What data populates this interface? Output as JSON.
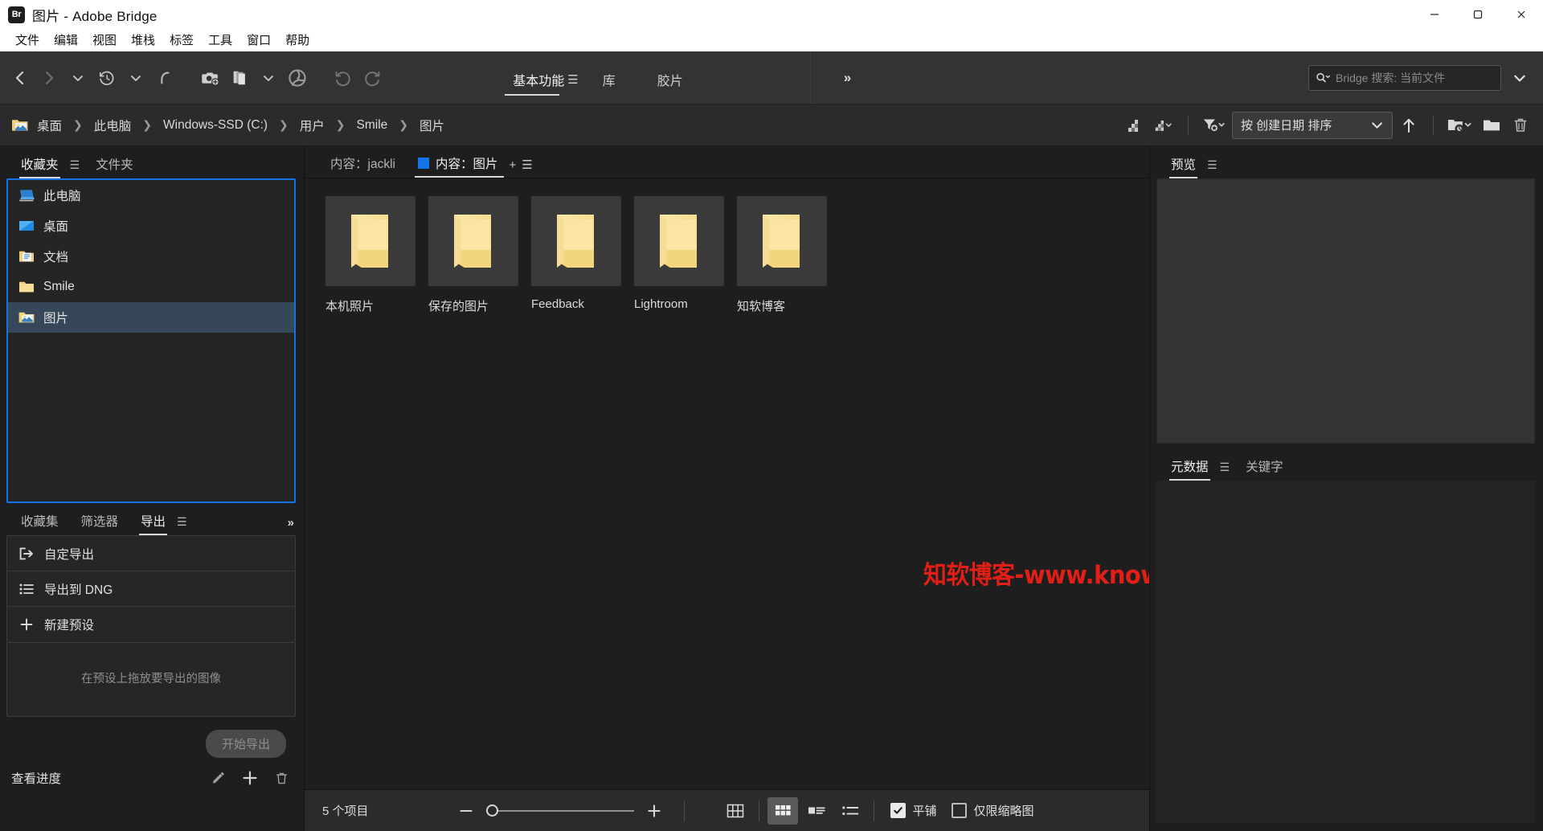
{
  "window": {
    "app_badge": "Br",
    "title": "图片 - Adobe Bridge",
    "controls": {
      "minimize": "minimize-icon",
      "maximize": "maximize-icon",
      "close": "close-icon"
    }
  },
  "menubar": {
    "items": [
      {
        "label": "文件"
      },
      {
        "label": "编辑"
      },
      {
        "label": "视图"
      },
      {
        "label": "堆栈"
      },
      {
        "label": "标签"
      },
      {
        "label": "工具"
      },
      {
        "label": "窗口"
      },
      {
        "label": "帮助"
      }
    ]
  },
  "toolbar": {
    "nav": [
      {
        "name": "back-icon",
        "title": "后退"
      },
      {
        "name": "forward-icon",
        "title": "前进"
      },
      {
        "name": "chevron-down-icon",
        "title": "最近访问"
      },
      {
        "name": "history-clock-icon",
        "title": "历史记录"
      },
      {
        "name": "chevron-down-icon",
        "title": "历史记录菜单"
      },
      {
        "name": "go-to-parent-icon",
        "title": "转到父文件夹"
      }
    ],
    "tools": [
      {
        "name": "camera-import-icon",
        "title": "从相机获取照片"
      },
      {
        "name": "copy-files-icon",
        "title": "优化照片"
      },
      {
        "name": "chevron-down-icon",
        "title": "优化菜单"
      },
      {
        "name": "aperture-icon",
        "title": "在 Camera Raw 中打开"
      }
    ],
    "rotate": [
      {
        "name": "rotate-ccw-icon",
        "title": "逆时针旋转"
      },
      {
        "name": "rotate-cw-icon",
        "title": "顺时针旋转"
      }
    ],
    "workspaces": [
      {
        "label": "基本功能",
        "active": true
      },
      {
        "label": "库",
        "active": false
      },
      {
        "label": "胶片",
        "active": false
      }
    ],
    "workspace_menu_icon": "hamburger-icon",
    "overflow_label": "»",
    "search": {
      "icon": "search-icon",
      "placeholder": "Bridge 搜索: 当前文件",
      "value": "",
      "dropdown_icon": "chevron-down-icon"
    }
  },
  "pathbar": {
    "root_icon": "pictures-folder-icon",
    "crumbs": [
      {
        "label": "桌面"
      },
      {
        "label": "此电脑"
      },
      {
        "label": "Windows-SSD (C:)"
      },
      {
        "label": "用户"
      },
      {
        "label": "Smile"
      },
      {
        "label": "图片"
      }
    ],
    "separator": "❯",
    "actions": [
      {
        "name": "rating-filter-icon",
        "title": "按评级过滤"
      },
      {
        "name": "rating-filter-menu-icon",
        "title": "评级菜单"
      },
      {
        "name": "filter-funnel-icon",
        "title": "筛选项目"
      }
    ],
    "sort": {
      "label": "按 创建日期 排序",
      "dropdown_icon": "chevron-down-icon"
    },
    "sort_direction_icon": "arrow-up-icon",
    "right_actions": [
      {
        "name": "recent-folders-icon",
        "title": "最近的文件夹"
      },
      {
        "name": "new-folder-icon",
        "title": "新建文件夹"
      },
      {
        "name": "delete-icon",
        "title": "删除项目"
      }
    ]
  },
  "left_panel": {
    "tabs": [
      {
        "label": "收藏夹",
        "active": true
      },
      {
        "label": "文件夹",
        "active": false
      }
    ],
    "menu_icon": "hamburger-icon",
    "favorites": [
      {
        "label": "此电脑",
        "icon": "computer-icon",
        "selected": false
      },
      {
        "label": "桌面",
        "icon": "desktop-icon",
        "selected": false
      },
      {
        "label": "文档",
        "icon": "documents-icon",
        "selected": false
      },
      {
        "label": "Smile",
        "icon": "folder-icon",
        "selected": false
      },
      {
        "label": "图片",
        "icon": "pictures-folder-icon",
        "selected": true
      }
    ]
  },
  "export_panel": {
    "tabs": [
      {
        "label": "收藏集",
        "active": false
      },
      {
        "label": "筛选器",
        "active": false
      },
      {
        "label": "导出",
        "active": true
      }
    ],
    "menu_icon": "hamburger-icon",
    "overflow_label": "»",
    "presets": [
      {
        "label": "自定导出",
        "icon": "export-arrow-icon"
      },
      {
        "label": "导出到 DNG",
        "icon": "list-icon"
      },
      {
        "label": "新建预设",
        "icon": "plus-icon"
      }
    ],
    "dropzone_text": "在预设上拖放要导出的图像",
    "start_button": {
      "label": "开始导出",
      "disabled": true
    },
    "progress_label": "查看进度",
    "foot_icons": [
      {
        "name": "pencil-icon",
        "title": "编辑预设"
      },
      {
        "name": "plus-icon",
        "title": "添加预设"
      },
      {
        "name": "trash-icon",
        "title": "删除预设"
      }
    ]
  },
  "content": {
    "tabs": [
      {
        "label": "内容：jackli",
        "active": false,
        "has_square": false
      },
      {
        "label": "内容：图片",
        "active": true,
        "has_square": true
      }
    ],
    "add_tab_icon": "plus-icon",
    "menu_icon": "hamburger-icon",
    "items": [
      {
        "name": "本机照片",
        "type": "folder"
      },
      {
        "name": "保存的图片",
        "type": "folder"
      },
      {
        "name": "Feedback",
        "type": "folder"
      },
      {
        "name": "Lightroom",
        "type": "folder"
      },
      {
        "name": "知软博客",
        "type": "folder"
      }
    ],
    "watermark": "知软博客-www.knowr.cn",
    "watermark_color": "#e21f16"
  },
  "statusbar": {
    "item_count": "5 个项目",
    "zoom_out_icon": "minus-icon",
    "zoom_in_icon": "plus-icon",
    "slider_value": 0,
    "view_modes": [
      {
        "name": "grid-view-icon",
        "active": false
      },
      {
        "name": "thumbnail-view-icon",
        "active": true
      },
      {
        "name": "details-view-icon",
        "active": false
      },
      {
        "name": "list-view-icon",
        "active": false
      }
    ],
    "checkboxes": [
      {
        "label": "平铺",
        "checked": true
      },
      {
        "label": "仅限缩略图",
        "checked": false
      }
    ]
  },
  "right_panel": {
    "preview": {
      "tabs": [
        {
          "label": "预览",
          "active": true
        }
      ],
      "menu_icon": "hamburger-icon"
    },
    "metadata": {
      "tabs": [
        {
          "label": "元数据",
          "active": true
        },
        {
          "label": "关键字",
          "active": false
        }
      ],
      "menu_icon": "hamburger-icon"
    }
  },
  "colors": {
    "accent_blue": "#1473e6",
    "selection_blue": "#37475a",
    "folder_yellow": "#f2d98d",
    "watermark_red": "#e21f16"
  }
}
